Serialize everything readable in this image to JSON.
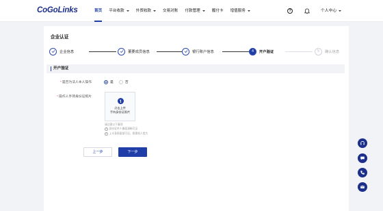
{
  "brand": {
    "logo": "CoGoLinks",
    "accent": "#1f3ea8"
  },
  "nav": {
    "items": [
      {
        "label": "首页",
        "active": true,
        "dropdown": false
      },
      {
        "label": "平台收款",
        "active": false,
        "dropdown": true
      },
      {
        "label": "外贸收款",
        "active": false,
        "dropdown": true
      },
      {
        "label": "交易对账",
        "active": false,
        "dropdown": false
      },
      {
        "label": "付款管理",
        "active": false,
        "dropdown": true
      },
      {
        "label": "履付卡",
        "active": false,
        "dropdown": false
      },
      {
        "label": "增值服务",
        "active": false,
        "dropdown": true
      }
    ],
    "help_icon": "question-circle-icon",
    "bell_icon": "bell-icon",
    "user_menu": "个人中心"
  },
  "page": {
    "title": "企业认证",
    "steps": [
      {
        "num": "1",
        "label": "企业信息",
        "status": "done"
      },
      {
        "num": "2",
        "label": "董要成员信息",
        "status": "done"
      },
      {
        "num": "3",
        "label": "银行账户信息",
        "status": "done"
      },
      {
        "num": "4",
        "label": "开户验证",
        "status": "current"
      },
      {
        "num": "5",
        "label": "确认信息",
        "status": "pending"
      }
    ],
    "section_title": "开户验证",
    "form": {
      "is_legal_label": "是否为法人本人操作",
      "option_yes": "是",
      "option_no": "否",
      "selected": "是",
      "upload_label": "操作人手持身份证照片",
      "upload_line1": "点击上传",
      "upload_line2": "手持身份证照片",
      "hint_title": "请注意以下事项",
      "hints": [
        {
          "num": "1",
          "text": "身份证件人像面清晰可见"
        },
        {
          "num": "2",
          "text": "上半身照面部可见，照需机人脸大"
        }
      ]
    },
    "buttons": {
      "prev": "上一步",
      "next": "下一步"
    }
  },
  "float_buttons": [
    "headset-icon",
    "chat-icon",
    "phone-icon",
    "mail-icon"
  ]
}
